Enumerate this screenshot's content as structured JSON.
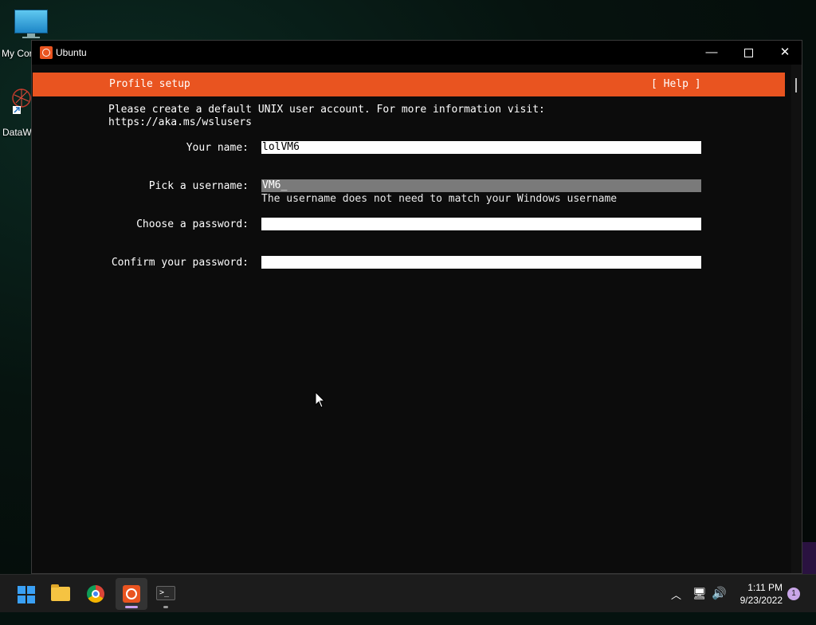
{
  "desktop": {
    "icons": [
      {
        "label": "My Cor"
      },
      {
        "label": "DataW"
      }
    ]
  },
  "window": {
    "title": "Ubuntu",
    "controls": {
      "minimize": "—",
      "close": "✕"
    }
  },
  "installer": {
    "header_title": "Profile setup",
    "help_label": "[ Help ]",
    "intro_line1": "Please create a default UNIX user account. For more information visit:",
    "intro_line2": "https://aka.ms/wslusers",
    "fields": {
      "name": {
        "label": "Your name:",
        "value": "lolVM6"
      },
      "username": {
        "label": "Pick a username:",
        "value": "VM6_",
        "hint": "The username does not need to match your Windows username"
      },
      "password": {
        "label": "Choose a password:",
        "value": ""
      },
      "confirm": {
        "label": "Confirm your password:",
        "value": ""
      }
    }
  },
  "taskbar": {
    "apps": [
      "start-icon",
      "file-explorer-icon",
      "chrome-icon",
      "ubuntu-icon",
      "terminal-icon"
    ],
    "terminal_glyph": ">_",
    "tray": {
      "chevron": "︿",
      "network": "🖥",
      "volume": "🔊"
    },
    "time": "1:11 PM",
    "date": "9/23/2022",
    "notification_count": "1"
  },
  "colors": {
    "accent": "#e95420",
    "terminal_bg": "#0c0c0c",
    "taskbar_bg": "#1c1c1c"
  }
}
